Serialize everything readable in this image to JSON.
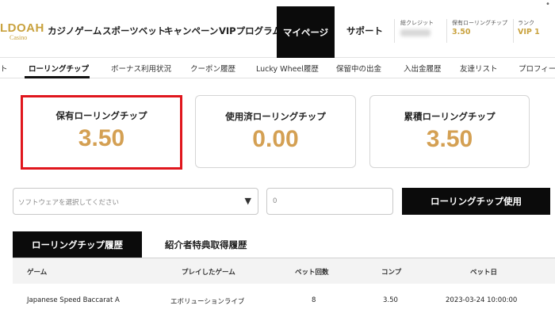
{
  "header": {
    "logo_main": "LDOAH",
    "logo_sub": "Casino",
    "nav": [
      "カジノゲーム",
      "スポーツベット",
      "キャンペーン",
      "VIPプログラム",
      "マイページ",
      "サポート"
    ],
    "stats": [
      {
        "label": "総クレジット",
        "value": ""
      },
      {
        "label": "保有ローリングチップ",
        "value": "3.50"
      },
      {
        "label": "ランク",
        "value": "VIP 1"
      }
    ]
  },
  "subtabs": [
    "ト",
    "ローリングチップ",
    "ボーナス利用状況",
    "クーポン履歴",
    "Lucky Wheel履歴",
    "保留中の出金",
    "入出金履歴",
    "友達リスト",
    "プロフィー"
  ],
  "cards": [
    {
      "title": "保有ローリングチップ",
      "value": "3.50"
    },
    {
      "title": "使用済ローリングチップ",
      "value": "0.00"
    },
    {
      "title": "累積ローリングチップ",
      "value": "3.50"
    }
  ],
  "form": {
    "select_placeholder": "ソフトウェアを選択してください",
    "amount_value": "0",
    "use_button": "ローリングチップ使用"
  },
  "history_tabs": [
    "ローリングチップ履歴",
    "紹介者特典取得履歴"
  ],
  "table": {
    "columns": [
      "ゲーム",
      "プレイしたゲーム",
      "ベット回数",
      "コンプ",
      "ベット日"
    ],
    "rows": [
      [
        "Japanese Speed Baccarat A",
        "エボリューションライブ",
        "8",
        "3.50",
        "2023-03-24 10:00:00"
      ]
    ]
  },
  "colors": {
    "accent_gold": "#d4a053",
    "highlight_red": "#e0161d",
    "active_black": "#0b0b0b"
  }
}
